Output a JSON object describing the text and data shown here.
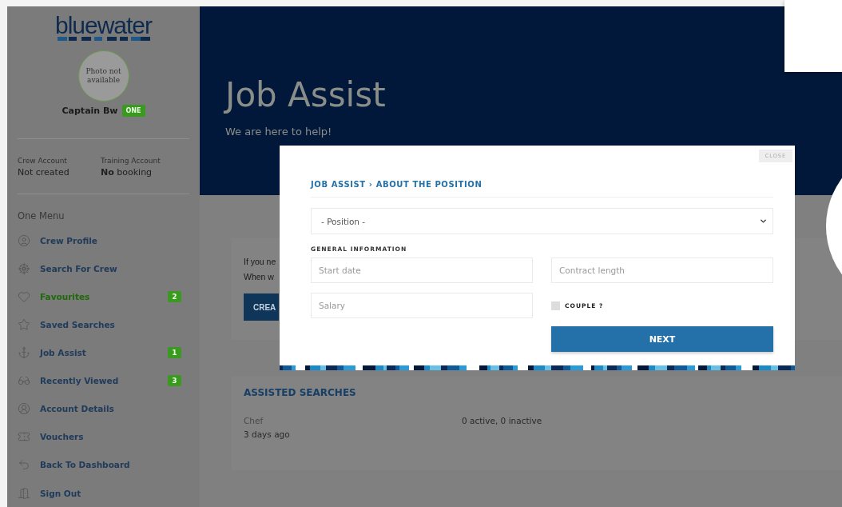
{
  "sidebar": {
    "logo": "bluewater",
    "photo_text": "Photo not available",
    "user_name": "Captain Bw",
    "user_badge": "ONE",
    "accounts": [
      {
        "label": "Crew Account",
        "value": "Not created"
      },
      {
        "label": "Training Account",
        "value": "**No** booking"
      }
    ],
    "menu_title": "One Menu",
    "items": [
      {
        "label": "Crew Profile",
        "selected": false
      },
      {
        "label": "Search For Crew",
        "selected": false
      },
      {
        "label": "Favourites",
        "selected": true,
        "badge": "2"
      },
      {
        "label": "Saved Searches",
        "selected": false
      },
      {
        "label": "Job Assist",
        "selected": false,
        "badge": "1"
      },
      {
        "label": "Recently Viewed",
        "selected": false,
        "badge": "3"
      },
      {
        "label": "Account Details",
        "selected": false
      },
      {
        "label": "Vouchers",
        "selected": false
      },
      {
        "label": "Back To Dashboard",
        "selected": false
      },
      {
        "label": "Sign Out",
        "selected": false
      }
    ]
  },
  "hero": {
    "title": "Job Assist",
    "subtitle": "We are here to help!"
  },
  "intro_card": {
    "lines": [
      "If you ne",
      "When w"
    ],
    "button": "CREA"
  },
  "assisted_searches": {
    "title": "ASSISTED SEARCHES",
    "rows": [
      {
        "name": "Chef",
        "time": "3 days ago",
        "status": "0 active, 0 inactive"
      }
    ]
  },
  "modal": {
    "close": "CLOSE",
    "breadcrumb": "JOB ASSIST › ABOUT THE POSITION",
    "position_select": {
      "value": "- Position -"
    },
    "section_title": "GENERAL INFORMATION",
    "fields": [
      {
        "placeholder": "Start date"
      },
      {
        "placeholder": "Contract length"
      },
      {
        "placeholder": "Salary"
      }
    ],
    "couple_checkbox": {
      "label": "COUPLE ?",
      "checked": false
    },
    "next_button": "NEXT"
  }
}
